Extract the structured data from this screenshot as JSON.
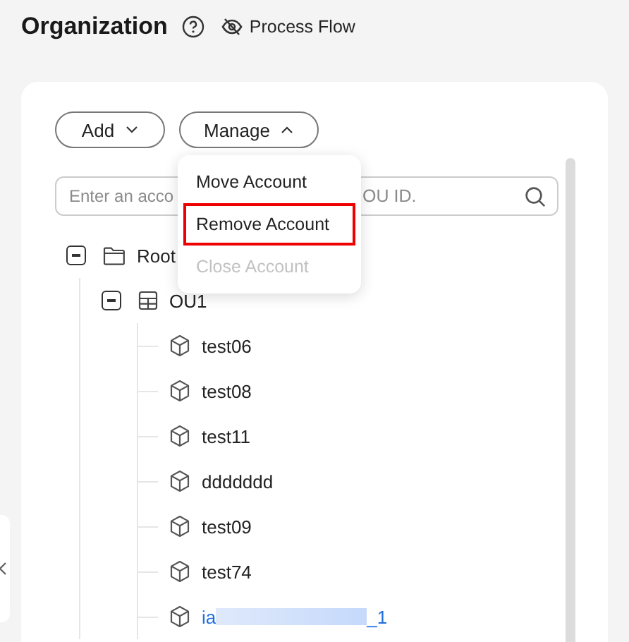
{
  "header": {
    "title": "Organization",
    "process_flow": "Process Flow"
  },
  "toolbar": {
    "buttons": [
      {
        "label": "Add",
        "expanded": false
      },
      {
        "label": "Manage",
        "expanded": true
      }
    ]
  },
  "manage_menu": {
    "items": [
      {
        "label": "Move Account",
        "disabled": false,
        "highlighted": false
      },
      {
        "label": "Remove Account",
        "disabled": false,
        "highlighted": true
      },
      {
        "label": "Close Account",
        "disabled": true,
        "highlighted": false
      }
    ]
  },
  "search": {
    "placeholder": "Enter an acco",
    "placeholder_end": "OU ID."
  },
  "tree": [
    {
      "kind": "root",
      "label": "Root",
      "expanded": true,
      "children": [
        {
          "kind": "ou",
          "label": "OU1",
          "expanded": true,
          "children": [
            {
              "kind": "account",
              "label": "test06",
              "selected": false
            },
            {
              "kind": "account",
              "label": "test08",
              "selected": false
            },
            {
              "kind": "account",
              "label": "test11",
              "selected": false
            },
            {
              "kind": "account",
              "label": "ddddddd",
              "selected": false
            },
            {
              "kind": "account",
              "label": "test09",
              "selected": false
            },
            {
              "kind": "account",
              "label": "test74",
              "selected": false
            },
            {
              "kind": "account",
              "label": "ia",
              "label_end": "_1",
              "redacted": true,
              "selected": true
            }
          ]
        }
      ]
    }
  ]
}
